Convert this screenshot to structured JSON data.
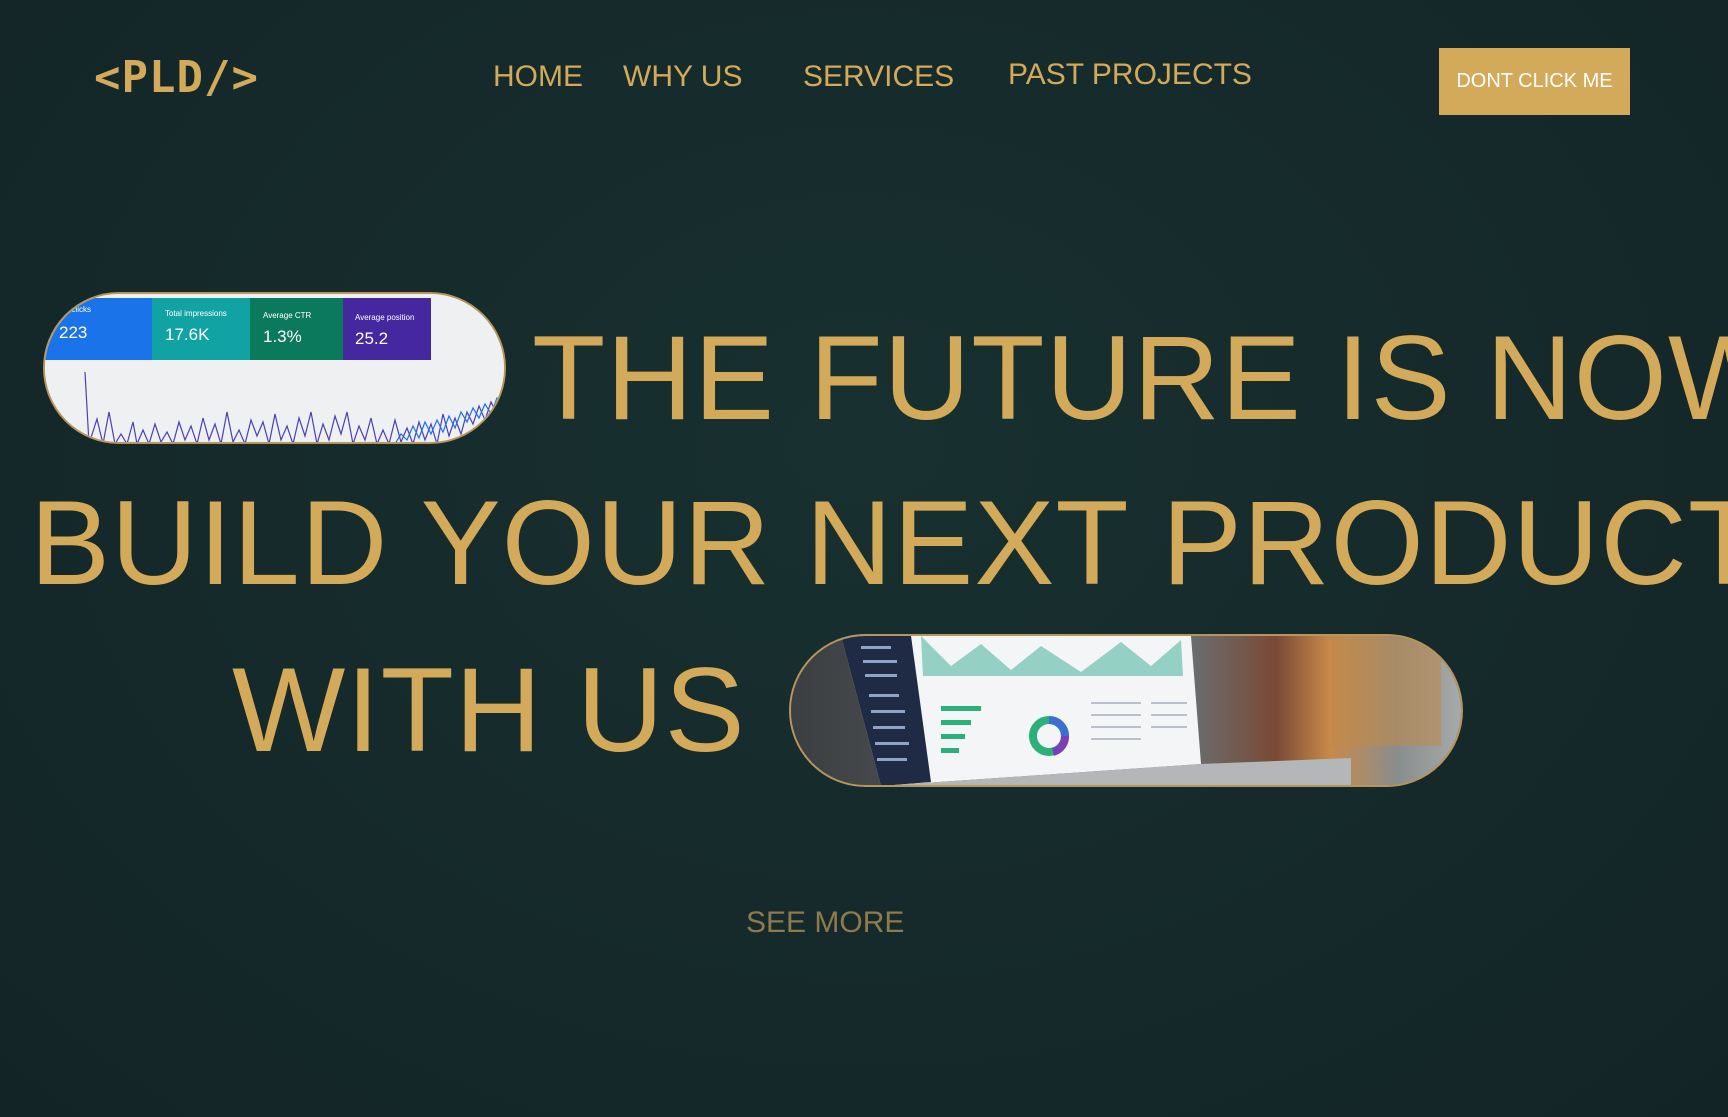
{
  "logo": {
    "text": "<PLD/>"
  },
  "nav": {
    "home": "HOME",
    "why_us": "WHY US",
    "services": "SERVICES",
    "past_projects": "PAST PROJECTS",
    "cta": "DONT CLICK ME"
  },
  "hero": {
    "line1": "THE FUTURE IS NOW",
    "line2": "BUILD YOUR NEXT PRODUCT",
    "line3": "WITH US",
    "see_more": "SEE MORE"
  },
  "analytics_image": {
    "tiles": [
      {
        "label": "al clicks",
        "value": "223",
        "color": "#1a73e8"
      },
      {
        "label": "Total impressions",
        "value": "17.6K",
        "color": "#11a3a3"
      },
      {
        "label": "Average CTR",
        "value": "1.3%",
        "color": "#0b7a5c"
      },
      {
        "label": "Average position",
        "value": "25.2",
        "color": "#4527a0"
      }
    ]
  },
  "colors": {
    "background": "#16282a",
    "accent": "#d3a95a",
    "see_more": "#8c7b4c"
  }
}
